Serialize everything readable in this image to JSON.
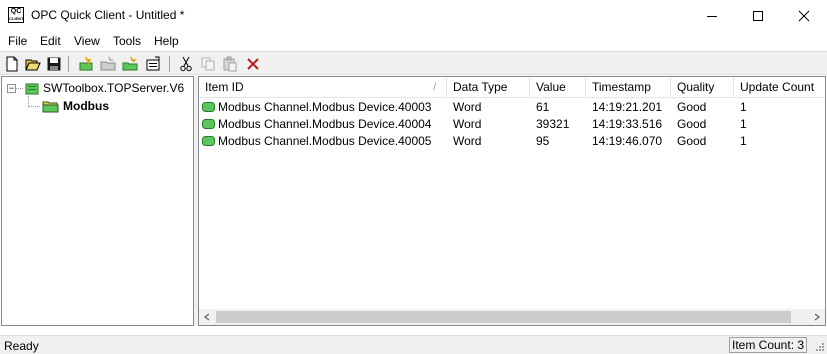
{
  "window": {
    "title": "OPC Quick Client - Untitled *",
    "icon_text_top": "QC",
    "icon_text_bottom": "CLIENT",
    "icon_name": "opc-quick-client-app-icon"
  },
  "menu": {
    "items": [
      "File",
      "Edit",
      "View",
      "Tools",
      "Help"
    ]
  },
  "toolbar": {
    "buttons": [
      {
        "name": "new-document-icon"
      },
      {
        "name": "open-folder-icon"
      },
      {
        "name": "save-disk-icon"
      },
      {
        "name": "new-server-connection-icon"
      },
      {
        "name": "new-group-icon"
      },
      {
        "name": "new-item-icon"
      },
      {
        "name": "properties-icon"
      },
      {
        "name": "cut-scissors-icon"
      },
      {
        "name": "copy-icon"
      },
      {
        "name": "paste-icon"
      },
      {
        "name": "delete-x-icon"
      }
    ]
  },
  "tree": {
    "server": {
      "label": "SWToolbox.TOPServer.V6",
      "expand_glyph": "−"
    },
    "group": {
      "label": "Modbus"
    }
  },
  "list": {
    "columns": [
      "Item ID",
      "Data Type",
      "Value",
      "Timestamp",
      "Quality",
      "Update Count"
    ],
    "rows": [
      {
        "item_id": "Modbus Channel.Modbus Device.40003",
        "data_type": "Word",
        "value": "61",
        "timestamp": "14:19:21.201",
        "quality": "Good",
        "update_count": "1"
      },
      {
        "item_id": "Modbus Channel.Modbus Device.40004",
        "data_type": "Word",
        "value": "39321",
        "timestamp": "14:19:33.516",
        "quality": "Good",
        "update_count": "1"
      },
      {
        "item_id": "Modbus Channel.Modbus Device.40005",
        "data_type": "Word",
        "value": "95",
        "timestamp": "14:19:46.070",
        "quality": "Good",
        "update_count": "1"
      }
    ],
    "sort_glyph": "/"
  },
  "status": {
    "text": "Ready",
    "item_count": "Item Count: 3"
  },
  "colors": {
    "tag_green": "#5cc85c",
    "folder_yellow": "#e8c84a"
  }
}
